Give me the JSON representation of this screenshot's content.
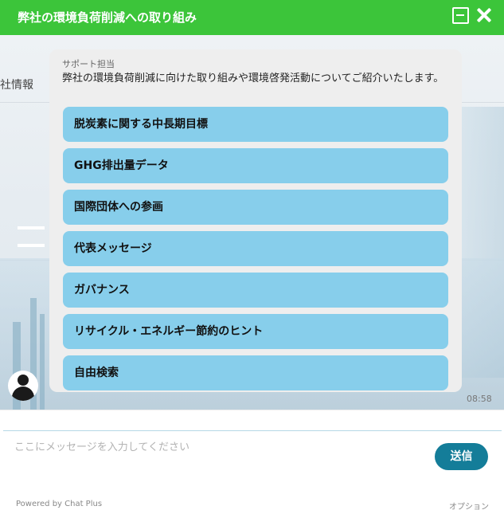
{
  "window": {
    "title": "弊社の環境負荷削減への取り組み",
    "titlebar_color": "#3cc53a",
    "minimize_icon": "minimize-icon",
    "close_icon": "close-icon"
  },
  "background": {
    "left_text": "社情報"
  },
  "message": {
    "sender": "サポート担当",
    "text": "弊社の環境負荷削減に向けた取り組みや環境啓発活動についてご紹介いたします。",
    "options": [
      {
        "label": "脱炭素に関する中長期目標"
      },
      {
        "label": "GHG排出量データ"
      },
      {
        "label": "国際団体への参画"
      },
      {
        "label": "代表メッセージ"
      },
      {
        "label": "ガバナンス"
      },
      {
        "label": "リサイクル・エネルギー節約のヒント"
      },
      {
        "label": "自由検索"
      }
    ],
    "option_color": "#87ceeb",
    "time": "08:58",
    "avatar_icon": "person-icon"
  },
  "composer": {
    "placeholder": "ここにメッセージを入力してください",
    "send_label": "送信",
    "send_color": "#147d99"
  },
  "footer": {
    "powered_by": "Powered by Chat Plus",
    "options_label": "オプション"
  }
}
